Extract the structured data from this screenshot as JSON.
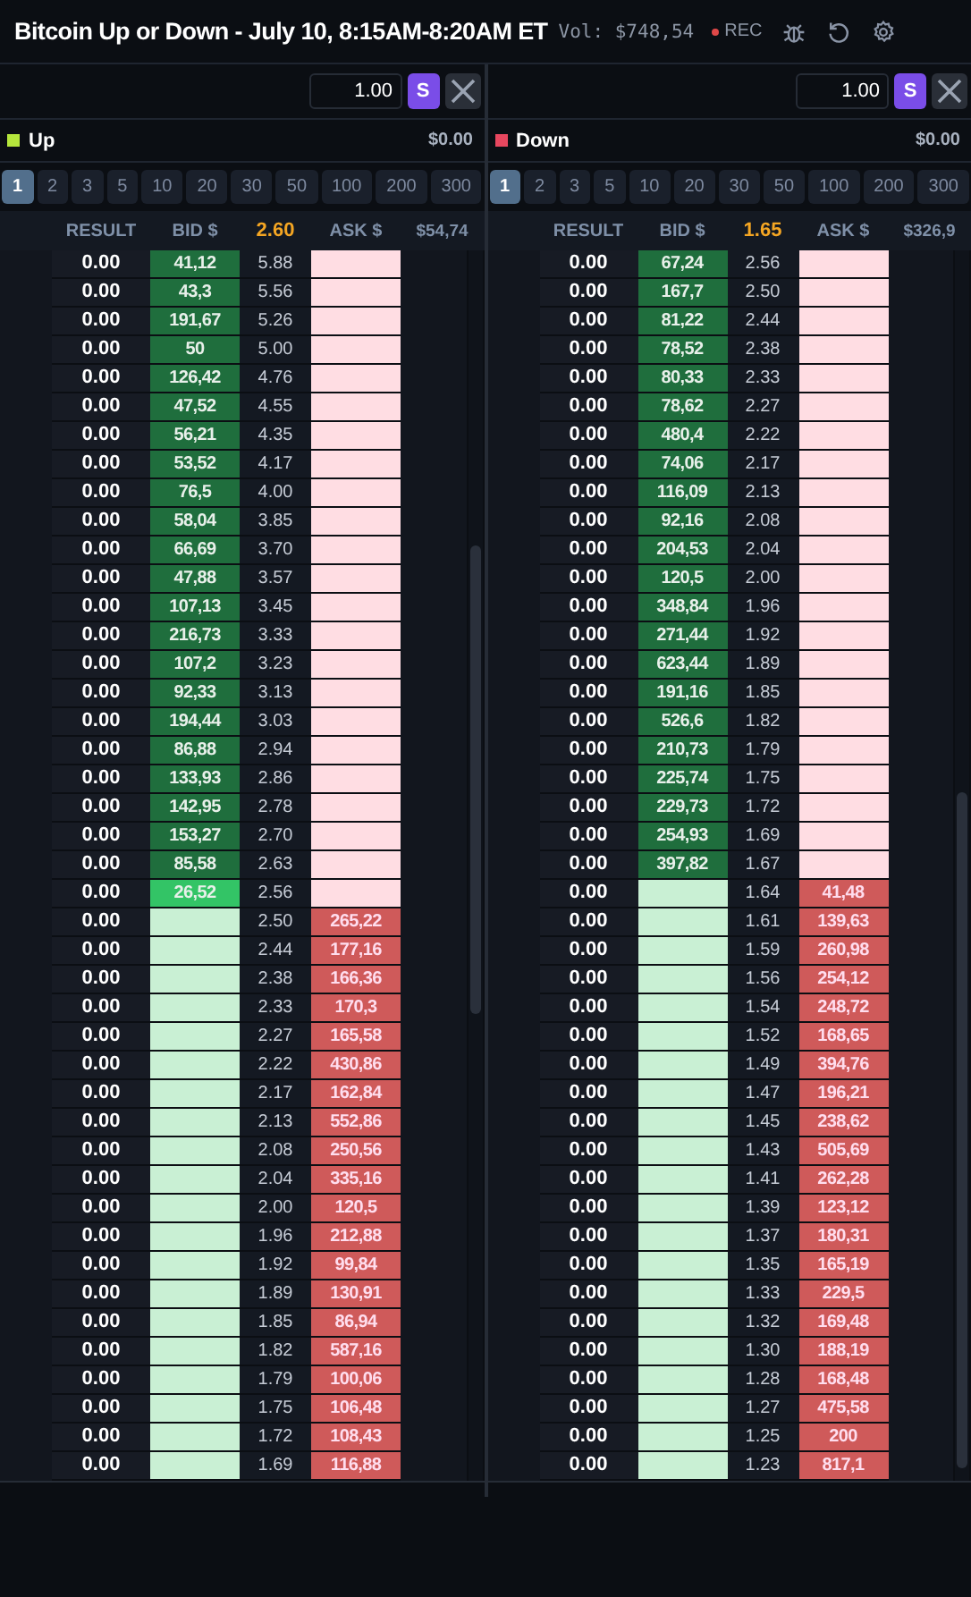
{
  "title": "Bitcoin Up or Down - July 10, 8:15AM-8:20AM ET",
  "volume": "Vol: $748,54",
  "rec": "REC",
  "markets": [
    {
      "amount": "1.00",
      "s_button": "S",
      "outcome": "Up",
      "color": "#b5e63c",
      "balance": "$0.00",
      "sizes": [
        {
          "label": "1",
          "selected": true
        },
        {
          "label": "2",
          "selected": false
        },
        {
          "label": "3",
          "selected": false
        },
        {
          "label": "5",
          "selected": false
        },
        {
          "label": "10",
          "selected": false
        },
        {
          "label": "20",
          "selected": false
        },
        {
          "label": "30",
          "selected": false
        },
        {
          "label": "50",
          "selected": false
        },
        {
          "label": "100",
          "selected": false
        },
        {
          "label": "200",
          "selected": false
        },
        {
          "label": "300",
          "selected": false
        }
      ],
      "columns": {
        "result": "RESULT",
        "bid": "BID $",
        "price": "2.60",
        "ask": "ASK $",
        "total": "$54,74"
      },
      "rows": [
        {
          "kind": "bid",
          "result": "0.00",
          "size": "41,12",
          "price": "5.88"
        },
        {
          "kind": "bid",
          "result": "0.00",
          "size": "43,3",
          "price": "5.56"
        },
        {
          "kind": "bid",
          "result": "0.00",
          "size": "191,67",
          "price": "5.26"
        },
        {
          "kind": "bid",
          "result": "0.00",
          "size": "50",
          "price": "5.00"
        },
        {
          "kind": "bid",
          "result": "0.00",
          "size": "126,42",
          "price": "4.76"
        },
        {
          "kind": "bid",
          "result": "0.00",
          "size": "47,52",
          "price": "4.55"
        },
        {
          "kind": "bid",
          "result": "0.00",
          "size": "56,21",
          "price": "4.35"
        },
        {
          "kind": "bid",
          "result": "0.00",
          "size": "53,52",
          "price": "4.17"
        },
        {
          "kind": "bid",
          "result": "0.00",
          "size": "76,5",
          "price": "4.00"
        },
        {
          "kind": "bid",
          "result": "0.00",
          "size": "58,04",
          "price": "3.85"
        },
        {
          "kind": "bid",
          "result": "0.00",
          "size": "66,69",
          "price": "3.70"
        },
        {
          "kind": "bid",
          "result": "0.00",
          "size": "47,88",
          "price": "3.57"
        },
        {
          "kind": "bid",
          "result": "0.00",
          "size": "107,13",
          "price": "3.45"
        },
        {
          "kind": "bid",
          "result": "0.00",
          "size": "216,73",
          "price": "3.33"
        },
        {
          "kind": "bid",
          "result": "0.00",
          "size": "107,2",
          "price": "3.23"
        },
        {
          "kind": "bid",
          "result": "0.00",
          "size": "92,33",
          "price": "3.13"
        },
        {
          "kind": "bid",
          "result": "0.00",
          "size": "194,44",
          "price": "3.03"
        },
        {
          "kind": "bid",
          "result": "0.00",
          "size": "86,88",
          "price": "2.94"
        },
        {
          "kind": "bid",
          "result": "0.00",
          "size": "133,93",
          "price": "2.86"
        },
        {
          "kind": "bid",
          "result": "0.00",
          "size": "142,95",
          "price": "2.78"
        },
        {
          "kind": "bid",
          "result": "0.00",
          "size": "153,27",
          "price": "2.70"
        },
        {
          "kind": "bid",
          "result": "0.00",
          "size": "85,58",
          "price": "2.63"
        },
        {
          "kind": "best_bid",
          "result": "0.00",
          "size": "26,52",
          "price": "2.56"
        },
        {
          "kind": "ask",
          "result": "0.00",
          "size": "265,22",
          "price": "2.50"
        },
        {
          "kind": "ask",
          "result": "0.00",
          "size": "177,16",
          "price": "2.44"
        },
        {
          "kind": "ask",
          "result": "0.00",
          "size": "166,36",
          "price": "2.38"
        },
        {
          "kind": "ask",
          "result": "0.00",
          "size": "170,3",
          "price": "2.33"
        },
        {
          "kind": "ask",
          "result": "0.00",
          "size": "165,58",
          "price": "2.27"
        },
        {
          "kind": "ask",
          "result": "0.00",
          "size": "430,86",
          "price": "2.22"
        },
        {
          "kind": "ask",
          "result": "0.00",
          "size": "162,84",
          "price": "2.17"
        },
        {
          "kind": "ask",
          "result": "0.00",
          "size": "552,86",
          "price": "2.13"
        },
        {
          "kind": "ask",
          "result": "0.00",
          "size": "250,56",
          "price": "2.08"
        },
        {
          "kind": "ask",
          "result": "0.00",
          "size": "335,16",
          "price": "2.04"
        },
        {
          "kind": "ask",
          "result": "0.00",
          "size": "120,5",
          "price": "2.00"
        },
        {
          "kind": "ask",
          "result": "0.00",
          "size": "212,88",
          "price": "1.96"
        },
        {
          "kind": "ask",
          "result": "0.00",
          "size": "99,84",
          "price": "1.92"
        },
        {
          "kind": "ask",
          "result": "0.00",
          "size": "130,91",
          "price": "1.89"
        },
        {
          "kind": "ask",
          "result": "0.00",
          "size": "86,94",
          "price": "1.85"
        },
        {
          "kind": "ask",
          "result": "0.00",
          "size": "587,16",
          "price": "1.82"
        },
        {
          "kind": "ask",
          "result": "0.00",
          "size": "100,06",
          "price": "1.79"
        },
        {
          "kind": "ask",
          "result": "0.00",
          "size": "106,48",
          "price": "1.75"
        },
        {
          "kind": "ask",
          "result": "0.00",
          "size": "108,43",
          "price": "1.72"
        },
        {
          "kind": "ask",
          "result": "0.00",
          "size": "116,88",
          "price": "1.69"
        }
      ]
    },
    {
      "amount": "1.00",
      "s_button": "S",
      "outcome": "Down",
      "color": "#e8475f",
      "balance": "$0.00",
      "sizes": [
        {
          "label": "1",
          "selected": true
        },
        {
          "label": "2",
          "selected": false
        },
        {
          "label": "3",
          "selected": false
        },
        {
          "label": "5",
          "selected": false
        },
        {
          "label": "10",
          "selected": false
        },
        {
          "label": "20",
          "selected": false
        },
        {
          "label": "30",
          "selected": false
        },
        {
          "label": "50",
          "selected": false
        },
        {
          "label": "100",
          "selected": false
        },
        {
          "label": "200",
          "selected": false
        },
        {
          "label": "300",
          "selected": false
        }
      ],
      "columns": {
        "result": "RESULT",
        "bid": "BID $",
        "price": "1.65",
        "ask": "ASK $",
        "total": "$326,9"
      },
      "rows": [
        {
          "kind": "bid",
          "result": "0.00",
          "size": "67,24",
          "price": "2.56"
        },
        {
          "kind": "bid",
          "result": "0.00",
          "size": "167,7",
          "price": "2.50"
        },
        {
          "kind": "bid",
          "result": "0.00",
          "size": "81,22",
          "price": "2.44"
        },
        {
          "kind": "bid",
          "result": "0.00",
          "size": "78,52",
          "price": "2.38"
        },
        {
          "kind": "bid",
          "result": "0.00",
          "size": "80,33",
          "price": "2.33"
        },
        {
          "kind": "bid",
          "result": "0.00",
          "size": "78,62",
          "price": "2.27"
        },
        {
          "kind": "bid",
          "result": "0.00",
          "size": "480,4",
          "price": "2.22"
        },
        {
          "kind": "bid",
          "result": "0.00",
          "size": "74,06",
          "price": "2.17"
        },
        {
          "kind": "bid",
          "result": "0.00",
          "size": "116,09",
          "price": "2.13"
        },
        {
          "kind": "bid",
          "result": "0.00",
          "size": "92,16",
          "price": "2.08"
        },
        {
          "kind": "bid",
          "result": "0.00",
          "size": "204,53",
          "price": "2.04"
        },
        {
          "kind": "bid",
          "result": "0.00",
          "size": "120,5",
          "price": "2.00"
        },
        {
          "kind": "bid",
          "result": "0.00",
          "size": "348,84",
          "price": "1.96"
        },
        {
          "kind": "bid",
          "result": "0.00",
          "size": "271,44",
          "price": "1.92"
        },
        {
          "kind": "bid",
          "result": "0.00",
          "size": "623,44",
          "price": "1.89"
        },
        {
          "kind": "bid",
          "result": "0.00",
          "size": "191,16",
          "price": "1.85"
        },
        {
          "kind": "bid",
          "result": "0.00",
          "size": "526,6",
          "price": "1.82"
        },
        {
          "kind": "bid",
          "result": "0.00",
          "size": "210,73",
          "price": "1.79"
        },
        {
          "kind": "bid",
          "result": "0.00",
          "size": "225,74",
          "price": "1.75"
        },
        {
          "kind": "bid",
          "result": "0.00",
          "size": "229,73",
          "price": "1.72"
        },
        {
          "kind": "bid",
          "result": "0.00",
          "size": "254,93",
          "price": "1.69"
        },
        {
          "kind": "bid",
          "result": "0.00",
          "size": "397,82",
          "price": "1.67"
        },
        {
          "kind": "ask",
          "result": "0.00",
          "size": "41,48",
          "price": "1.64"
        },
        {
          "kind": "ask",
          "result": "0.00",
          "size": "139,63",
          "price": "1.61"
        },
        {
          "kind": "ask",
          "result": "0.00",
          "size": "260,98",
          "price": "1.59"
        },
        {
          "kind": "ask",
          "result": "0.00",
          "size": "254,12",
          "price": "1.56"
        },
        {
          "kind": "ask",
          "result": "0.00",
          "size": "248,72",
          "price": "1.54"
        },
        {
          "kind": "ask",
          "result": "0.00",
          "size": "168,65",
          "price": "1.52"
        },
        {
          "kind": "ask",
          "result": "0.00",
          "size": "394,76",
          "price": "1.49"
        },
        {
          "kind": "ask",
          "result": "0.00",
          "size": "196,21",
          "price": "1.47"
        },
        {
          "kind": "ask",
          "result": "0.00",
          "size": "238,62",
          "price": "1.45"
        },
        {
          "kind": "ask",
          "result": "0.00",
          "size": "505,69",
          "price": "1.43"
        },
        {
          "kind": "ask",
          "result": "0.00",
          "size": "262,28",
          "price": "1.41"
        },
        {
          "kind": "ask",
          "result": "0.00",
          "size": "123,12",
          "price": "1.39"
        },
        {
          "kind": "ask",
          "result": "0.00",
          "size": "180,31",
          "price": "1.37"
        },
        {
          "kind": "ask",
          "result": "0.00",
          "size": "165,19",
          "price": "1.35"
        },
        {
          "kind": "ask",
          "result": "0.00",
          "size": "229,5",
          "price": "1.33"
        },
        {
          "kind": "ask",
          "result": "0.00",
          "size": "169,48",
          "price": "1.32"
        },
        {
          "kind": "ask",
          "result": "0.00",
          "size": "188,19",
          "price": "1.30"
        },
        {
          "kind": "ask",
          "result": "0.00",
          "size": "168,48",
          "price": "1.28"
        },
        {
          "kind": "ask",
          "result": "0.00",
          "size": "475,58",
          "price": "1.27"
        },
        {
          "kind": "ask",
          "result": "0.00",
          "size": "200",
          "price": "1.25"
        },
        {
          "kind": "ask",
          "result": "0.00",
          "size": "817,1",
          "price": "1.23"
        }
      ]
    }
  ]
}
